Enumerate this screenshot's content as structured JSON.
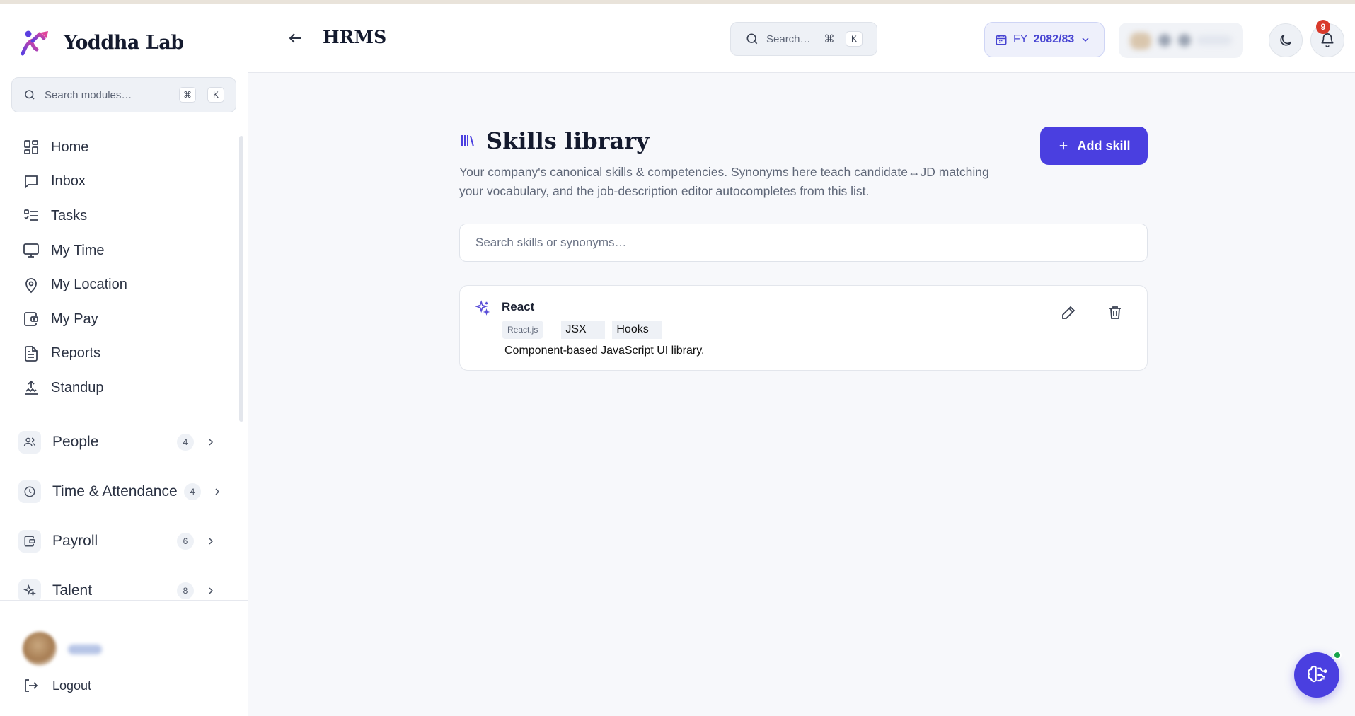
{
  "brand": {
    "name": "Yoddha Lab"
  },
  "sidebar": {
    "search_placeholder": "Search modules…",
    "search_keys": [
      "⌘",
      "K"
    ],
    "nav": [
      {
        "label": "Home",
        "icon": "grid-icon"
      },
      {
        "label": "Inbox",
        "icon": "message-icon"
      },
      {
        "label": "Tasks",
        "icon": "tasks-icon"
      },
      {
        "label": "My Time",
        "icon": "monitor-icon"
      },
      {
        "label": "My Location",
        "icon": "map-pin-icon"
      },
      {
        "label": "My Pay",
        "icon": "wallet-icon"
      },
      {
        "label": "Reports",
        "icon": "document-icon"
      },
      {
        "label": "Standup",
        "icon": "upload-icon"
      }
    ],
    "groups": [
      {
        "label": "People",
        "count": "4",
        "icon": "users-icon"
      },
      {
        "label": "Time & Attendance",
        "count": "4",
        "icon": "clock-icon"
      },
      {
        "label": "Payroll",
        "count": "6",
        "icon": "wallet-icon"
      },
      {
        "label": "Talent",
        "count": "8",
        "icon": "sparkles-icon"
      }
    ],
    "logout_label": "Logout"
  },
  "header": {
    "title": "HRMS",
    "search_placeholder": "Search…",
    "search_keys": [
      "⌘",
      "K"
    ],
    "fy_prefix": "FY",
    "fy_value": "2082/83",
    "notification_count": "9"
  },
  "page": {
    "title": "Skills library",
    "description": "Your company's canonical skills & competencies. Synonyms here teach candidate↔JD matching your vocabulary, and the job-description editor autocompletes from this list.",
    "add_button_label": "Add skill",
    "search_placeholder": "Search skills or synonyms…",
    "skills": [
      {
        "name": "React",
        "synonyms": [
          "React.js",
          "JSX",
          "Hooks"
        ],
        "description": "Component-based JavaScript UI library."
      }
    ]
  },
  "colors": {
    "accent": "#4a3fe0",
    "notification": "#d93a2b",
    "online": "#16a34a"
  }
}
